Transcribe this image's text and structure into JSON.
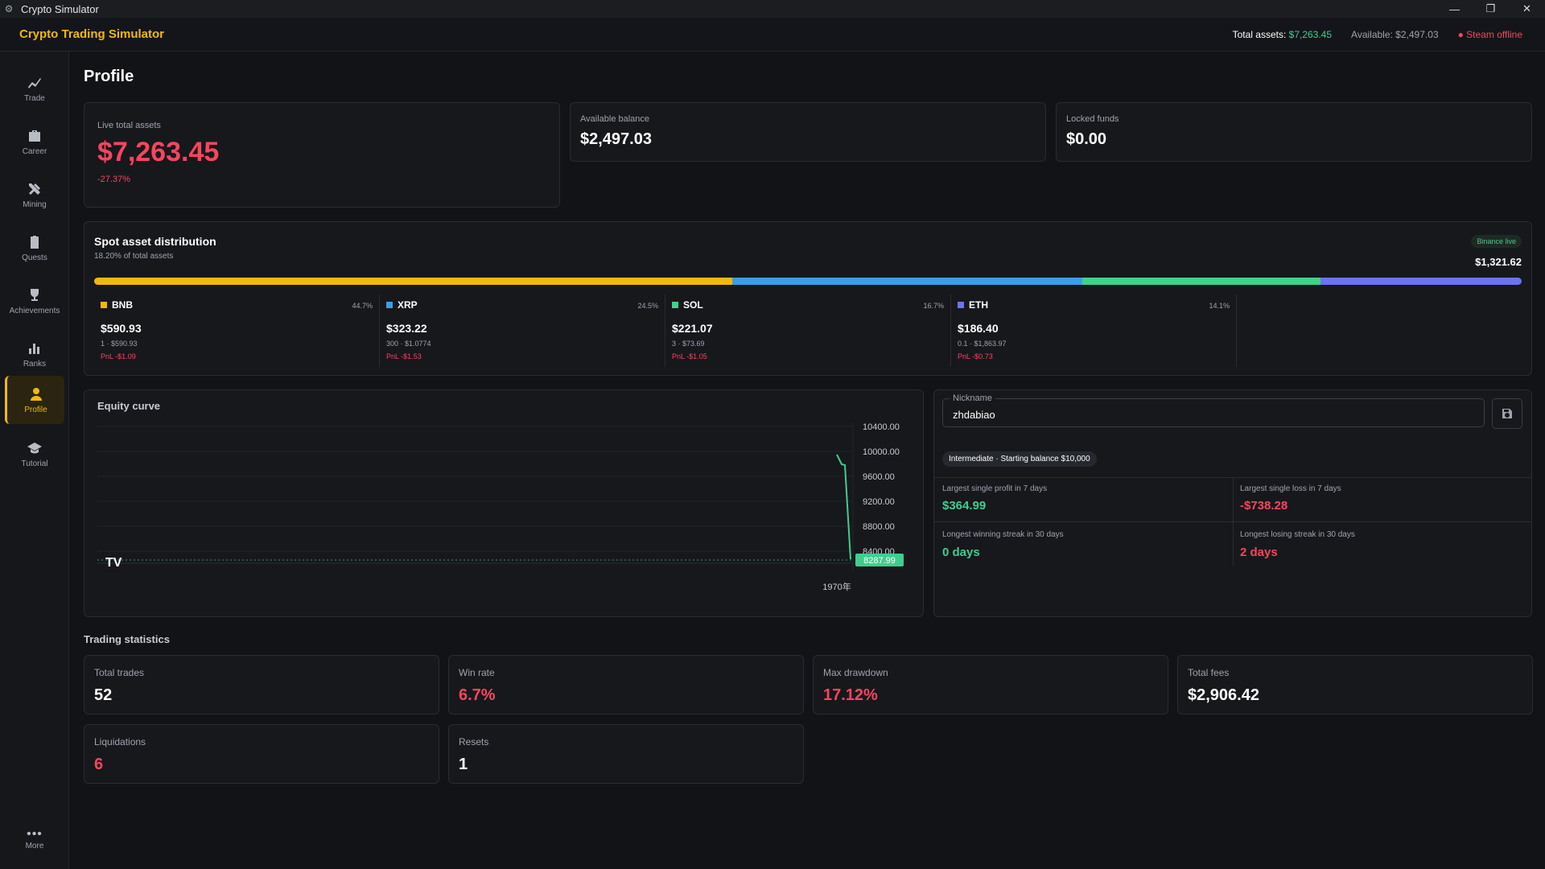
{
  "window": {
    "title": "Crypto Simulator",
    "controls": [
      "—",
      "❐",
      "✕"
    ]
  },
  "header": {
    "brand": "Crypto Trading Simulator",
    "total_assets_label": "Total assets:",
    "total_assets_value": "$7,263.45",
    "available": "Available: $2,497.03",
    "steam_status": "Steam offline"
  },
  "sidebar": {
    "items": [
      {
        "label": "Trade",
        "icon": "chart-line-icon"
      },
      {
        "label": "Career",
        "icon": "briefcase-icon"
      },
      {
        "label": "Mining",
        "icon": "tools-icon"
      },
      {
        "label": "Quests",
        "icon": "clipboard-icon"
      },
      {
        "label": "Achievements",
        "icon": "trophy-icon"
      },
      {
        "label": "Ranks",
        "icon": "bar-chart-icon"
      },
      {
        "label": "Profile",
        "icon": "user-icon"
      },
      {
        "label": "Tutorial",
        "icon": "graduation-cap-icon"
      }
    ],
    "more": "More",
    "active": "Profile"
  },
  "page": {
    "title": "Profile"
  },
  "summary": {
    "live_label": "Live total assets",
    "live_value": "$7,263.45",
    "live_change": "-27.37%",
    "available_label": "Available balance",
    "available_value": "$2,497.03",
    "locked_label": "Locked funds",
    "locked_value": "$0.00"
  },
  "spot": {
    "title": "Spot asset distribution",
    "subtitle": "18.20% of total assets",
    "badge": "Binance live",
    "total": "$1,321.62",
    "assets": [
      {
        "symbol": "BNB",
        "pct": "44.7%",
        "share": 44.7,
        "value": "$590.93",
        "qty": "1 · $590.93",
        "pnl": "PnL -$1.09",
        "color": "#f0b90b"
      },
      {
        "symbol": "XRP",
        "pct": "24.5%",
        "share": 24.5,
        "value": "$323.22",
        "qty": "300 · $1.0774",
        "pnl": "PnL -$1.53",
        "color": "#3b9ee8"
      },
      {
        "symbol": "SOL",
        "pct": "16.7%",
        "share": 16.7,
        "value": "$221.07",
        "qty": "3 · $73.69",
        "pnl": "PnL -$1.05",
        "color": "#3ed38a"
      },
      {
        "symbol": "ETH",
        "pct": "14.1%",
        "share": 14.1,
        "value": "$186.40",
        "qty": "0.1 · $1,863.97",
        "pnl": "PnL -$0.73",
        "color": "#6b74f0"
      }
    ]
  },
  "equity": {
    "title": "Equity curve",
    "y_ticks": [
      "10400.00",
      "10000.00",
      "9600.00",
      "9200.00",
      "8800.00",
      "8400.00"
    ],
    "last_value": "8287.99",
    "x_label": "1970年",
    "logo": "TV"
  },
  "profile": {
    "nickname_label": "Nickname",
    "nickname_value": "zhdabiao",
    "level_badge": "Intermediate · Starting balance $10,000",
    "largest_profit_label": "Largest single profit in 7 days",
    "largest_profit_value": "$364.99",
    "largest_loss_label": "Largest single loss in 7 days",
    "largest_loss_value": "-$738.28",
    "win_streak_label": "Longest winning streak in 30 days",
    "win_streak_value": "0 days",
    "lose_streak_label": "Longest losing streak in 30 days",
    "lose_streak_value": "2 days"
  },
  "stats": {
    "title": "Trading statistics",
    "items": [
      {
        "label": "Total trades",
        "value": "52",
        "color": "#ffffff"
      },
      {
        "label": "Win rate",
        "value": "6.7%",
        "color": "#f6465d"
      },
      {
        "label": "Max drawdown",
        "value": "17.12%",
        "color": "#f6465d"
      },
      {
        "label": "Total fees",
        "value": "$2,906.42",
        "color": "#ffffff"
      },
      {
        "label": "Liquidations",
        "value": "6",
        "color": "#f6465d"
      },
      {
        "label": "Resets",
        "value": "1",
        "color": "#ffffff"
      }
    ]
  }
}
